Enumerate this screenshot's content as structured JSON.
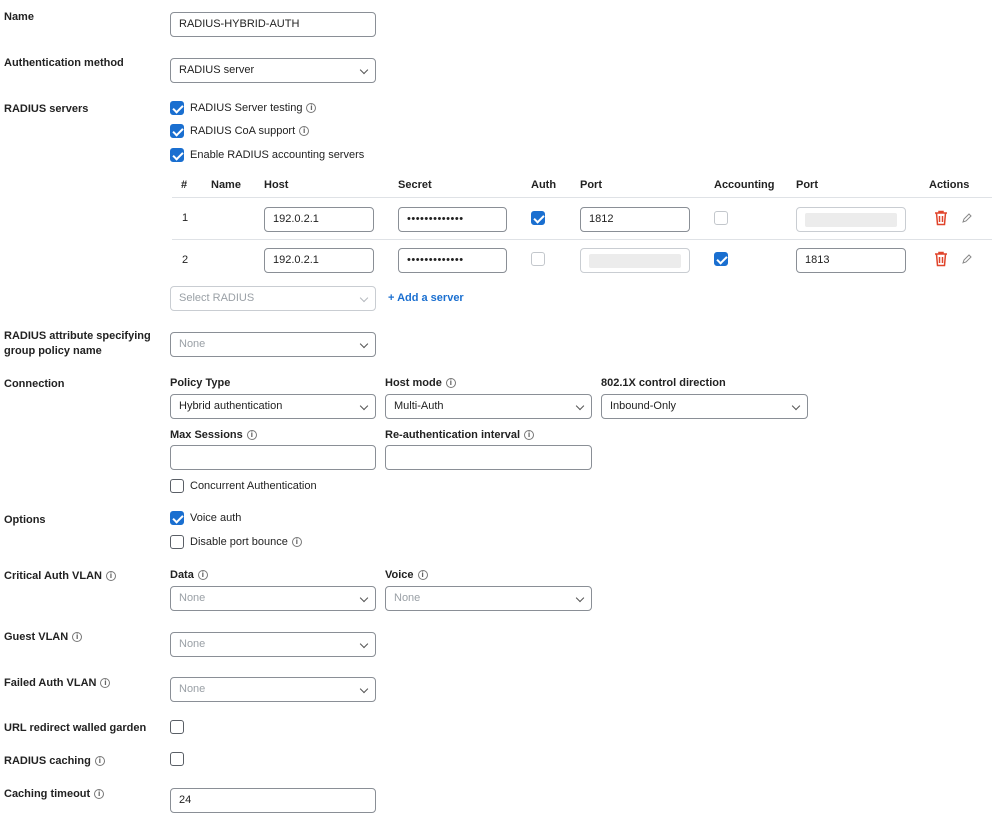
{
  "labels": {
    "name": "Name",
    "auth_method": "Authentication method",
    "radius_servers": "RADIUS servers",
    "radius_attribute": "RADIUS attribute specifying group policy name",
    "connection": "Connection",
    "options": "Options",
    "critical_vlan": "Critical Auth VLAN",
    "guest_vlan": "Guest VLAN",
    "failed_vlan": "Failed Auth VLAN",
    "url_redirect": "URL redirect walled garden",
    "radius_caching": "RADIUS caching",
    "caching_timeout": "Caching timeout"
  },
  "fields": {
    "name_value": "RADIUS-HYBRID-AUTH",
    "auth_method_value": "RADIUS server",
    "radius_attribute_value": "None",
    "caching_timeout_value": "24"
  },
  "radius_options": {
    "server_testing": "RADIUS Server testing",
    "coa_support": "RADIUS CoA support",
    "accounting_servers": "Enable RADIUS accounting servers"
  },
  "servers_table": {
    "headers": [
      "#",
      "Name",
      "Host",
      "Secret",
      "Auth",
      "Port",
      "Accounting",
      "Port",
      "Actions"
    ],
    "rows": [
      {
        "num": "1",
        "host": "192.0.2.1",
        "secret": "•••••••••••••",
        "auth": true,
        "port": "1812",
        "accounting": false,
        "acct_port": ""
      },
      {
        "num": "2",
        "host": "192.0.2.1",
        "secret": "•••••••••••••",
        "auth": false,
        "port": "",
        "accounting": true,
        "acct_port": "1813"
      }
    ],
    "select_placeholder": "Select RADIUS",
    "add_server": "+ Add a server"
  },
  "connection": {
    "policy_type_label": "Policy Type",
    "policy_type_value": "Hybrid authentication",
    "host_mode_label": "Host mode",
    "host_mode_value": "Multi-Auth",
    "control_direction_label": "802.1X control direction",
    "control_direction_value": "Inbound-Only",
    "max_sessions_label": "Max Sessions",
    "max_sessions_value": "",
    "reauth_label": "Re-authentication interval",
    "reauth_value": "",
    "concurrent_auth": "Concurrent Authentication"
  },
  "options": {
    "voice_auth": "Voice auth",
    "disable_port_bounce": "Disable port bounce"
  },
  "critical_vlan": {
    "data_label": "Data",
    "data_value": "None",
    "voice_label": "Voice",
    "voice_value": "None"
  },
  "guest_vlan_value": "None",
  "failed_vlan_value": "None",
  "colors": {
    "accent": "#1a6fd0",
    "danger": "#e0442b"
  }
}
